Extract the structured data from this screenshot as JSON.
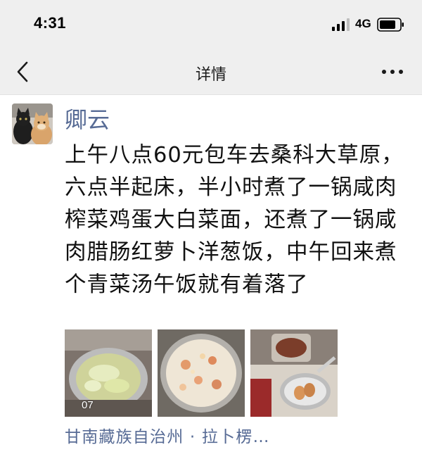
{
  "status_bar": {
    "time": "4:31",
    "network": "4G",
    "signal_icon": "signal-bars-icon",
    "battery_icon": "battery-icon"
  },
  "nav": {
    "title": "详情",
    "back_icon": "chevron-left-icon",
    "more_icon": "ellipsis-icon"
  },
  "post": {
    "author": "卿云",
    "text": "上午八点60元包车去桑科大草原，六点半起床，半小时煮了一锅咸肉榨菜鸡蛋大白菜面，还煮了一锅咸肉腊肠红萝卜洋葱饭，中午回来煮个青菜汤午饭就有着落了",
    "photos": [
      {
        "caption": "07",
        "subject": "noodle-pot-photo"
      },
      {
        "caption": "",
        "subject": "rice-cooker-photo"
      },
      {
        "caption": "",
        "subject": "eggs-in-pot-photo"
      }
    ],
    "location": "甘南藏族自治州 · 拉卜楞…"
  },
  "colors": {
    "link": "#576b95",
    "header_bg": "#efefef",
    "text": "#111111"
  }
}
